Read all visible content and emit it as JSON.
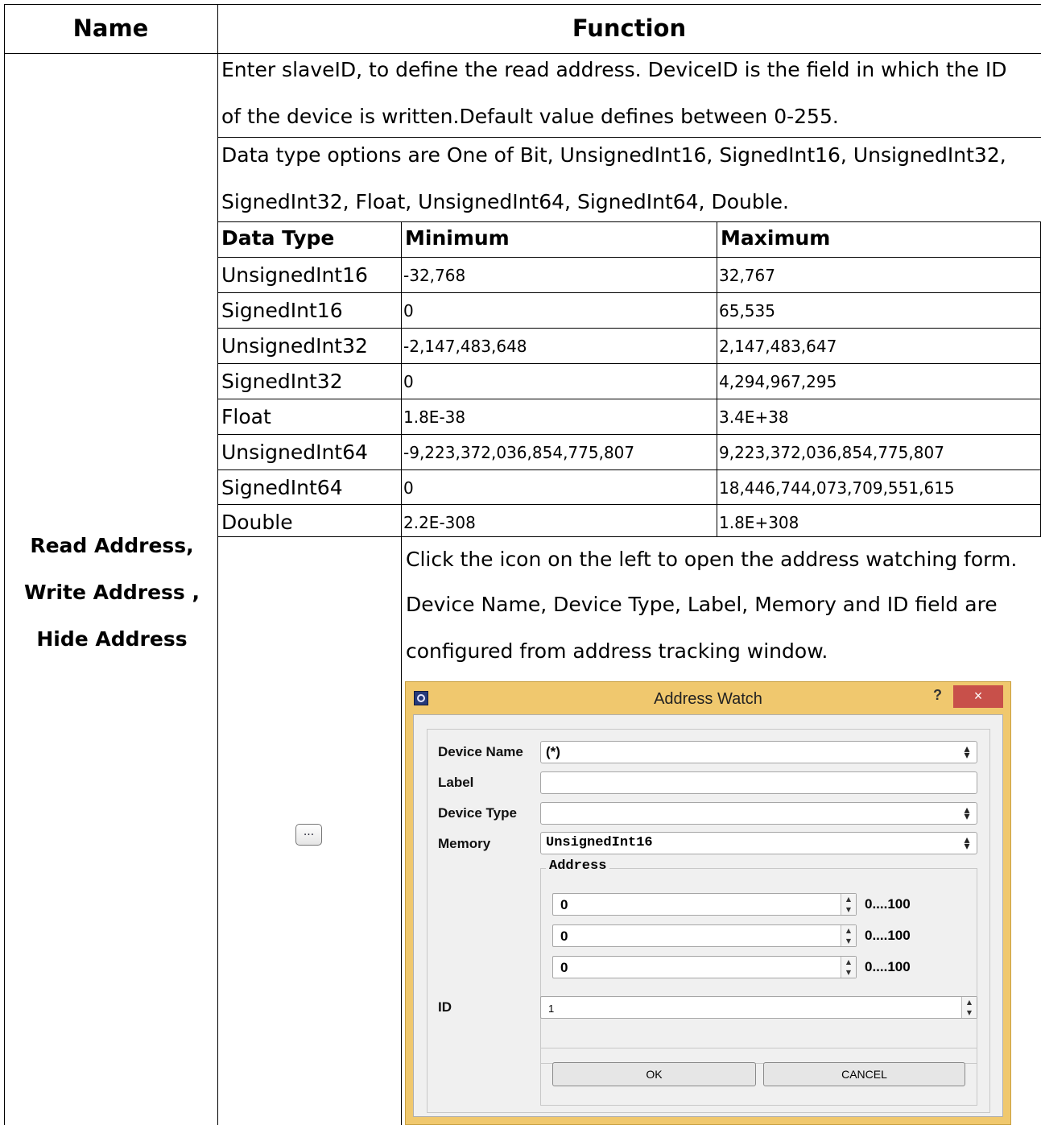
{
  "header": {
    "name": "Name",
    "function": "Function"
  },
  "name_cell": [
    "Read Address,",
    "Write Address ,",
    "Hide Address"
  ],
  "paragraph1": [
    "Enter slaveID, to define the read address. DeviceID is the field in which the ID",
    "of the device is written.Default value defines between 0-255."
  ],
  "paragraph2": [
    "Data type options are One of Bit, UnsignedInt16, SignedInt16, UnsignedInt32,",
    "SignedInt32, Float, UnsignedInt64, SignedInt64, Double."
  ],
  "types_table": {
    "headers": [
      "Data Type",
      "Minimum",
      "Maximum"
    ],
    "rows": [
      [
        "UnsignedInt16",
        "-32,768",
        "32,767"
      ],
      [
        "SignedInt16",
        "0",
        "65,535"
      ],
      [
        "UnsignedInt32",
        "-2,147,483,648",
        "2,147,483,647"
      ],
      [
        "SignedInt32",
        "0",
        "4,294,967,295"
      ],
      [
        "Float",
        "1.8E-38",
        "3.4E+38"
      ],
      [
        "UnsignedInt64",
        "-9,223,372,036,854,775,807",
        "9,223,372,036,854,775,807"
      ],
      [
        "SignedInt64",
        "0",
        "18,446,744,073,709,551,615"
      ],
      [
        "Double",
        "2.2E-308",
        "1.8E+308"
      ]
    ]
  },
  "ellipsis_button": "...",
  "paragraph3": [
    "Click the icon on the left to open the address watching form.",
    "Device Name, Device Type, Label, Memory and ID field are",
    "configured from address tracking window."
  ],
  "dialog": {
    "title": "Address Watch",
    "help": "?",
    "close": "×",
    "device_name_label": "Device Name",
    "device_name_value": "(*)",
    "label_label": "Label",
    "label_value": "",
    "device_type_label": "Device Type",
    "device_type_value": "",
    "memory_label": "Memory",
    "memory_value": "UnsignedInt16",
    "address_group": "Address",
    "addresses": [
      {
        "value": "0",
        "range": "0....100"
      },
      {
        "value": "0",
        "range": "0....100"
      },
      {
        "value": "0",
        "range": "0....100"
      }
    ],
    "id_label": "ID",
    "id_value": "1",
    "ok": "OK",
    "cancel": "CANCEL"
  }
}
